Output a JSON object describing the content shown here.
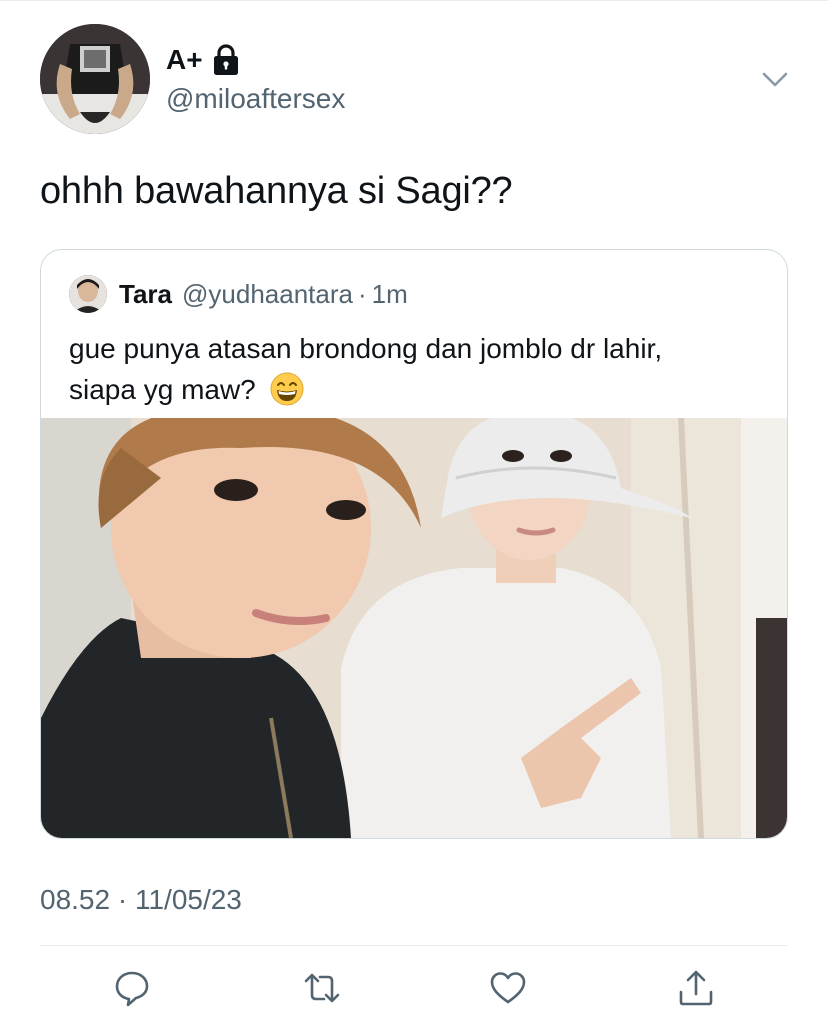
{
  "tweet": {
    "display_name": "A+",
    "handle": "@miloaftersex",
    "text": "ohhh bawahannya si Sagi??",
    "time": "08.52",
    "separator": "·",
    "date": "11/05/23",
    "icons": {
      "lock": "lock-icon",
      "more": "chevron-down-icon"
    }
  },
  "quoted": {
    "display_name": "Tara",
    "handle": "@yudhaantara",
    "separator": "·",
    "time": "1m",
    "line1": "gue punya atasan brondong dan jomblo dr lahir,",
    "line2": "siapa yg maw?",
    "emoji": "grinning-face-with-smiling-eyes"
  },
  "actions": [
    "reply-icon",
    "retweet-icon",
    "like-icon",
    "share-icon"
  ],
  "colors": {
    "text": "#0f1419",
    "secondary": "#536471",
    "border": "#cfd9de"
  }
}
